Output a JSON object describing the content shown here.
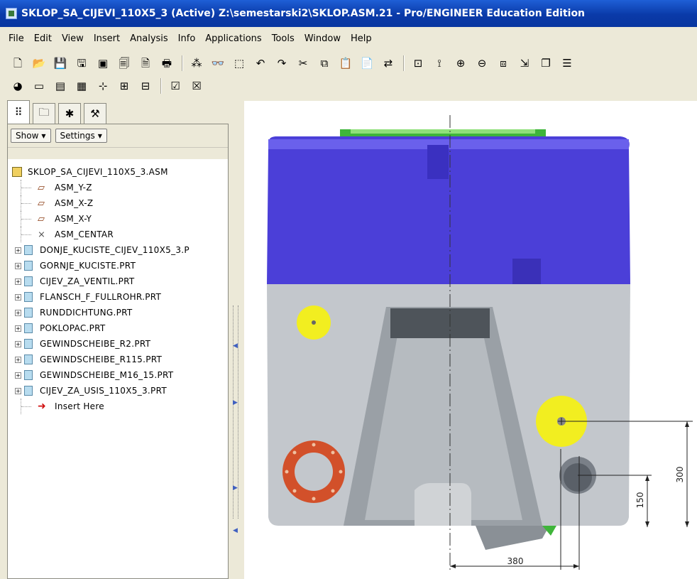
{
  "window": {
    "title": "SKLOP_SA_CIJEVI_110X5_3 (Active) Z:\\semestarski2\\SKLOP.ASM.21 - Pro/ENGINEER Education Edition"
  },
  "menu": [
    "File",
    "Edit",
    "View",
    "Insert",
    "Analysis",
    "Info",
    "Applications",
    "Tools",
    "Window",
    "Help"
  ],
  "toolbar1": [
    {
      "name": "new-icon",
      "glyph": "🗋"
    },
    {
      "name": "open-icon",
      "glyph": "📂"
    },
    {
      "name": "save-icon",
      "glyph": "💾"
    },
    {
      "name": "save-as-icon",
      "glyph": "🖫"
    },
    {
      "name": "backup-icon",
      "glyph": "▣"
    },
    {
      "name": "rename-icon",
      "glyph": "🗐"
    },
    {
      "name": "erase-icon",
      "glyph": "🗎"
    },
    {
      "name": "print-icon",
      "glyph": "🖶"
    },
    {
      "sep": true
    },
    {
      "name": "regenerate-icon",
      "glyph": "⁂"
    },
    {
      "name": "find-icon",
      "glyph": "👓"
    },
    {
      "name": "select-box-icon",
      "glyph": "⬚"
    },
    {
      "name": "undo-icon",
      "glyph": "↶"
    },
    {
      "name": "redo-icon",
      "glyph": "↷"
    },
    {
      "name": "cut-icon",
      "glyph": "✂"
    },
    {
      "name": "copy-icon",
      "glyph": "⧉"
    },
    {
      "name": "paste-icon",
      "glyph": "📋"
    },
    {
      "name": "paste-special-icon",
      "glyph": "📄"
    },
    {
      "name": "switch-icon",
      "glyph": "⇄"
    },
    {
      "sep": true
    },
    {
      "name": "spin-center-icon",
      "glyph": "⊡"
    },
    {
      "name": "orient-icon",
      "glyph": "⟟"
    },
    {
      "name": "zoom-in-icon",
      "glyph": "⊕"
    },
    {
      "name": "zoom-out-icon",
      "glyph": "⊖"
    },
    {
      "name": "refit-icon",
      "glyph": "⧈"
    },
    {
      "name": "reorient-icon",
      "glyph": "⇲"
    },
    {
      "name": "saved-views-icon",
      "glyph": "❐"
    },
    {
      "name": "layers-icon",
      "glyph": "☰"
    }
  ],
  "toolbar2": [
    {
      "name": "appearance-icon",
      "glyph": "◕"
    },
    {
      "name": "datum-planes-icon",
      "glyph": "▭"
    },
    {
      "name": "datum-axes-icon",
      "glyph": "▤"
    },
    {
      "name": "datum-points-icon",
      "glyph": "▦"
    },
    {
      "name": "csys-icon",
      "glyph": "⊹"
    },
    {
      "name": "datum-curves-icon",
      "glyph": "⊞"
    },
    {
      "name": "annotations-icon",
      "glyph": "⊟"
    },
    {
      "sep": true
    },
    {
      "name": "activate-window-icon",
      "glyph": "☑"
    },
    {
      "name": "close-window-icon",
      "glyph": "☒"
    }
  ],
  "nav": {
    "tabs": [
      {
        "name": "model-tree-tab-icon",
        "glyph": "⠿"
      },
      {
        "name": "folder-browser-tab-icon",
        "glyph": "🗀"
      },
      {
        "name": "favorites-tab-icon",
        "glyph": "✱"
      },
      {
        "name": "connections-tab-icon",
        "glyph": "⚒"
      }
    ],
    "show_label": "Show",
    "settings_label": "Settings"
  },
  "tree": [
    {
      "label": "SKLOP_SA_CIJEVI_110X5_3.ASM",
      "kind": "root"
    },
    {
      "label": "ASM_Y-Z",
      "kind": "plane"
    },
    {
      "label": "ASM_X-Z",
      "kind": "plane"
    },
    {
      "label": "ASM_X-Y",
      "kind": "plane"
    },
    {
      "label": "ASM_CENTAR",
      "kind": "csys"
    },
    {
      "label": "DONJE_KUCISTE_CIJEV_110X5_3.P",
      "kind": "part"
    },
    {
      "label": "GORNJE_KUCISTE.PRT",
      "kind": "part"
    },
    {
      "label": "CIJEV_ZA_VENTIL.PRT",
      "kind": "part"
    },
    {
      "label": "FLANSCH_F_FULLROHR.PRT",
      "kind": "part"
    },
    {
      "label": "RUNDDICHTUNG.PRT",
      "kind": "part"
    },
    {
      "label": "POKLOPAC.PRT",
      "kind": "part"
    },
    {
      "label": "GEWINDSCHEIBE_R2.PRT",
      "kind": "part"
    },
    {
      "label": "GEWINDSCHEIBE_R115.PRT",
      "kind": "part"
    },
    {
      "label": "GEWINDSCHEIBE_M16_15.PRT",
      "kind": "part"
    },
    {
      "label": "CIJEV_ZA_USIS_110X5_3.PRT",
      "kind": "part"
    },
    {
      "label": "Insert Here",
      "kind": "insert"
    }
  ],
  "dimensions": {
    "horizontal": "380",
    "vertical_small": "150",
    "vertical_large": "300"
  },
  "colors": {
    "top_housing": "#4b3fd8",
    "bottom_housing": "#c3c7cc",
    "yellow_washer": "#f2ee20",
    "flange": "#d2502a",
    "green_part": "#3fb53a"
  }
}
